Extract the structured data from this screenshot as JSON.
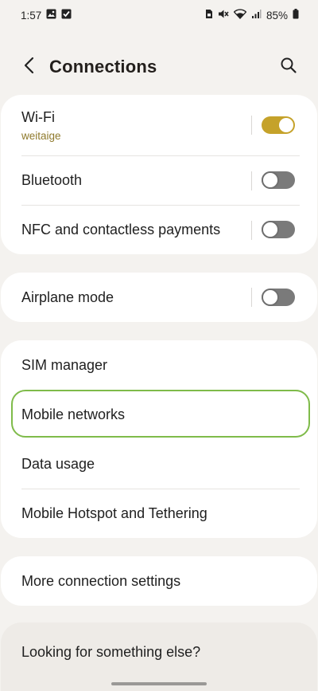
{
  "status_bar": {
    "time": "1:57",
    "battery": "85%",
    "left_icons": [
      "image-icon",
      "checkbox-icon"
    ],
    "right_icons": [
      "sim-lock-icon",
      "mute-icon",
      "wifi-icon",
      "signal-icon",
      "battery-icon"
    ]
  },
  "header": {
    "title": "Connections",
    "back_icon": "chevron-left-icon",
    "search_icon": "search-icon"
  },
  "groups": {
    "wireless": {
      "wifi": {
        "label": "Wi-Fi",
        "sub": "weitaige",
        "toggle": "on"
      },
      "bluetooth": {
        "label": "Bluetooth",
        "toggle": "off"
      },
      "nfc": {
        "label": "NFC and contactless payments",
        "toggle": "off"
      }
    },
    "airplane": {
      "label": "Airplane mode",
      "toggle": "off"
    },
    "network": {
      "sim": {
        "label": "SIM manager"
      },
      "mobile": {
        "label": "Mobile networks",
        "highlighted": true
      },
      "data": {
        "label": "Data usage"
      },
      "hotspot": {
        "label": "Mobile Hotspot and Tethering"
      }
    },
    "more": {
      "label": "More connection settings"
    },
    "looking": {
      "label": "Looking for something else?"
    }
  },
  "colors": {
    "background": "#f4f2ef",
    "card": "#ffffff",
    "accent": "#c5a22a",
    "highlight": "#7fbb4a",
    "subtext": "#8f7a2c"
  }
}
